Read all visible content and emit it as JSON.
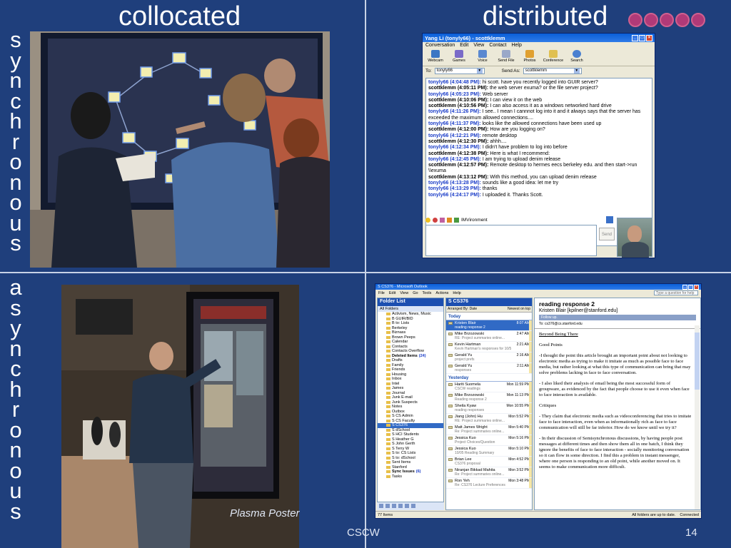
{
  "headers": {
    "collocated": "collocated",
    "distributed": "distributed"
  },
  "side_labels": {
    "synchronous": [
      "s",
      "y",
      "n",
      "c",
      "h",
      "r",
      "o",
      "n",
      "o",
      "u",
      "s"
    ],
    "asynchronous": [
      "a",
      "s",
      "y",
      "n",
      "c",
      "h",
      "r",
      "o",
      "n",
      "o",
      "u",
      "s"
    ]
  },
  "photo_caption": "Plasma Poster",
  "footer": {
    "title": "CSCW",
    "page": "14"
  },
  "colors": {
    "slide_bg": "#1f3f7c",
    "accent_logo": "#b03a78",
    "xp_blue": "#0a5fd8"
  },
  "im": {
    "title": "Yang Li (tonyly66) - scottklemm",
    "menu": [
      "Conversation",
      "Edit",
      "View",
      "Contact",
      "Help"
    ],
    "toolbar": [
      "Webcam",
      "Games",
      "Voice",
      "Send File",
      "Photos",
      "Conference",
      "Search"
    ],
    "to_label": "To:",
    "to_value": "tonyly66",
    "send_as_label": "Send As:",
    "send_as_value": "scottklemm",
    "messages": [
      {
        "who": "tonyly66 (4:04:48 PM):",
        "text": " hi scott. have you recently logged into GUIR server?",
        "t": true
      },
      {
        "who": "scottklemm (4:05:11 PM):",
        "text": " the web server exuma? or the file server project?",
        "t": false
      },
      {
        "who": "tonyly66 (4:05:23 PM):",
        "text": " Web server",
        "t": true
      },
      {
        "who": "scottklemm (4:10:06 PM):",
        "text": " I can view it on the web",
        "t": false
      },
      {
        "who": "scottklemm (4:10:56 PM):",
        "text": " I can also access it as a windows networked hard drive",
        "t": false
      },
      {
        "who": "tonyly66 (4:11:26 PM):",
        "text": " I see.. I mean I cannnot log into it and it always says that the server has exceeded the maximum allowed connections....",
        "t": true
      },
      {
        "who": "tonyly66 (4:11:37 PM):",
        "text": " looks like the allowed connections have been used up",
        "t": true
      },
      {
        "who": "scottklemm (4:12:00 PM):",
        "text": " How are you logging on?",
        "t": false
      },
      {
        "who": "tonyly66 (4:12:21 PM):",
        "text": " remote desktop",
        "t": true
      },
      {
        "who": "scottklemm (4:12:30 PM):",
        "text": " ahhh....",
        "t": false
      },
      {
        "who": "tonyly66 (4:12:34 PM):",
        "text": " I didn't have problem to log into before",
        "t": true
      },
      {
        "who": "scottklemm (4:12:38 PM):",
        "text": " Here is what I recommend:",
        "t": false
      },
      {
        "who": "tonyly66 (4:12:45 PM):",
        "text": " I am trying to upload denim release",
        "t": true
      },
      {
        "who": "scottklemm (4:12:57 PM):",
        "text": " Remote desktop to hermes eecs berkeley edu. and then start->run \\\\exuma",
        "t": false
      },
      {
        "who": "scottklemm (4:13:12 PM):",
        "text": " With this method, you can upload denim release",
        "t": false
      },
      {
        "who": "tonyly66 (4:13:28 PM):",
        "text": " sounds like a good idea: let me try",
        "t": true
      },
      {
        "who": "tonyly66 (4:13:29 PM):",
        "text": " thanks",
        "t": true
      },
      {
        "who": "tonyly66 (4:24:17 PM):",
        "text": " I uploaded it. Thanks Scott.",
        "t": true
      }
    ],
    "compose_label": "IMVironment",
    "send_label": "Send"
  },
  "outlook": {
    "title": "S CS376 - Microsoft Outlook",
    "menu": [
      "File",
      "Edit",
      "View",
      "Go",
      "Tools",
      "Actions",
      "Help"
    ],
    "ask_placeholder": "Type a question for help",
    "folder_list_title": "Folder List",
    "all_folders": "All Folders",
    "folders": [
      {
        "name": "Activism, News, Music"
      },
      {
        "name": "B GUIR/BID"
      },
      {
        "name": "B to: Lists"
      },
      {
        "name": "Berkeley"
      },
      {
        "name": "Biznass"
      },
      {
        "name": "Brown Peeps"
      },
      {
        "name": "Calendar"
      },
      {
        "name": "Contacts"
      },
      {
        "name": "Contacts Overflow"
      },
      {
        "name": "Deleted Items",
        "count": "(24)",
        "bold": true
      },
      {
        "name": "Drafts"
      },
      {
        "name": "Family"
      },
      {
        "name": "Friends"
      },
      {
        "name": "Housing"
      },
      {
        "name": "Inbox"
      },
      {
        "name": "Intel"
      },
      {
        "name": "James"
      },
      {
        "name": "Journal"
      },
      {
        "name": "Junk E-mail"
      },
      {
        "name": "Junk Suspects"
      },
      {
        "name": "Notes"
      },
      {
        "name": "Outbox"
      },
      {
        "name": "S CS Admin"
      },
      {
        "name": "S CS Faculty"
      },
      {
        "name": "S CS376",
        "sel": true
      },
      {
        "name": "S dSchool"
      },
      {
        "name": "S HCI Students"
      },
      {
        "name": "S Heather G"
      },
      {
        "name": "S John Gerth"
      },
      {
        "name": "S Terry W"
      },
      {
        "name": "S to: CS Lists"
      },
      {
        "name": "S to: dSchool"
      },
      {
        "name": "Sent Items"
      },
      {
        "name": "Stanford"
      },
      {
        "name": "Sync Issues",
        "count": "(6)",
        "bold": true
      },
      {
        "name": "Tasks"
      }
    ],
    "list_title": "S CS376",
    "arranged_by": "Arranged By: Date",
    "sort_order": "Newest on top",
    "groups": [
      {
        "label": "Today",
        "rows": [
          {
            "sender": "Kristen Blair",
            "date": "8:07 AM",
            "subject": "reading response 2",
            "sel": true
          },
          {
            "sender": "Mike Brzozowski",
            "date": "2:47 AM",
            "subject": "RE: Project summaries online..."
          },
          {
            "sender": "Kevin Hartman",
            "date": "2:21 AM",
            "subject": "Kevin Hartman's responses for 10/5"
          },
          {
            "sender": "Gerald Yu",
            "date": "2:16 AM",
            "subject": "project prefs"
          },
          {
            "sender": "Gerald Yu",
            "date": "2:11 AM",
            "subject": "responses"
          }
        ]
      },
      {
        "label": "Yesterday",
        "rows": [
          {
            "sender": "Hariti Suomela",
            "date": "Mon 11:59 PM",
            "subject": "CSCW readings"
          },
          {
            "sender": "Mike Brzozowski",
            "date": "Mon 11:13 PM",
            "subject": "Reading response 2"
          },
          {
            "sender": "Sheila Kyaw",
            "date": "Mon 10:55 PM",
            "subject": "reading responses"
          },
          {
            "sender": "Jiang (John) Hu",
            "date": "Mon 5:52 PM",
            "subject": "RE: Project summaries online..."
          },
          {
            "sender": "Matt James Wright",
            "date": "Mon 5:40 PM",
            "subject": "Re: Project summaries online..."
          },
          {
            "sender": "Jessica Kuo",
            "date": "Mon 5:16 PM",
            "subject": "Project Choices/Question"
          },
          {
            "sender": "Jessica Kuo",
            "date": "Mon 5:10 PM",
            "subject": "10/05 Reading Summary"
          },
          {
            "sender": "Brian Lee",
            "date": "Mon 4:52 PM",
            "subject": "CS376 proposal"
          },
          {
            "sender": "Niranjan Bikkad Mahita",
            "date": "Mon 3:52 PM",
            "subject": "Re: Project summaries online..."
          },
          {
            "sender": "Ron Yeh",
            "date": "Mon 3:48 PM",
            "subject": "Re: CS376 Lecture Preferences"
          }
        ]
      }
    ],
    "reading": {
      "subject": "reading response 2",
      "from": "Kristen Blair [kpilner@stanford.edu]",
      "followup": "Follow up.",
      "to": "To:  cs376@cs.stanford.edu",
      "heading": "Beyond Being There",
      "paragraphs": [
        "Good Points",
        "-I thought the point this article brought an important point about not looking to electronic media as trying to make it imitate as much as possible face to face media, but rather looking at what this type of communication can bring that may solve problems lacking in face to face conversation.",
        "-  I also liked their analysis of email being the most successful form of groupware, as evidenced by the fact that people choose to use it even when face to face interaction is available.",
        "Critiques",
        "-  They claim that electronic media such as videoconferencing that tries to imitate face to face interaction, even when as informationally rich as face to face communication will still be far inferior.  How do we know until we try it?",
        "-  In their discussion of Semisynchronous discussions, by having people post messages at different times and then show them all in one batch, I think they ignore the benefits of face to face interaction - socially monitoring conversation so it can flow in some direction.  I find this a problem in instant messenger, where one person is responding to an old point, while another moved on.  It seems to make communication more difficult."
      ]
    },
    "status_left": "77 Items",
    "status_right": "All folders are up to date.",
    "status_connected": "Connected"
  }
}
